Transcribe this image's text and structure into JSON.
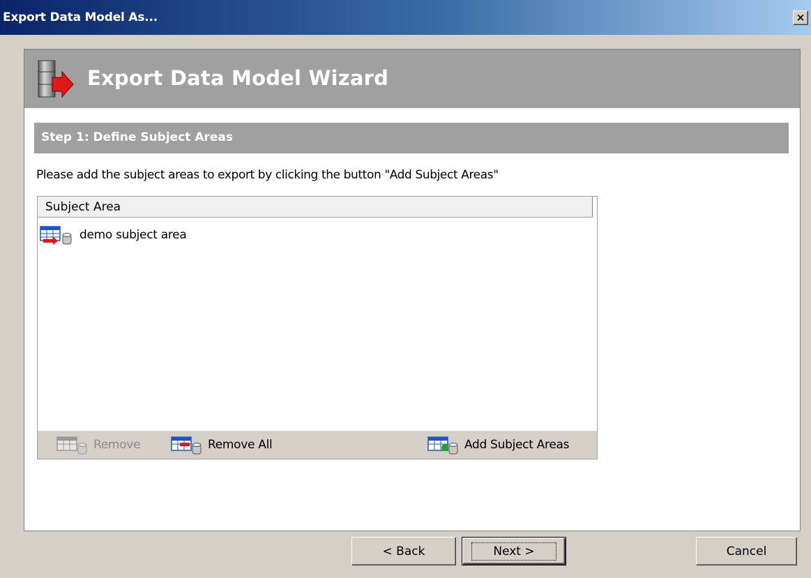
{
  "window": {
    "title": "Export Data Model As...",
    "close_label": "×"
  },
  "wizard": {
    "title": "Export Data Model Wizard",
    "step_title": "Step 1: Define Subject Areas",
    "instructions": "Please add the subject areas to export by clicking the button \"Add Subject Areas\""
  },
  "list": {
    "column_header": "Subject Area",
    "items": [
      {
        "label": "demo subject area",
        "icon": "subject-area-icon"
      }
    ]
  },
  "list_toolbar": {
    "remove_label": "Remove",
    "remove_all_label": "Remove All",
    "add_label": "Add Subject Areas"
  },
  "buttons": {
    "back": "< Back",
    "next": "Next >",
    "cancel": "Cancel"
  },
  "colors": {
    "title_bar_start": "#0a246a",
    "title_bar_end": "#a6caf0",
    "header_gray": "#a0a0a0",
    "dialog_bg": "#d4d0c8"
  }
}
